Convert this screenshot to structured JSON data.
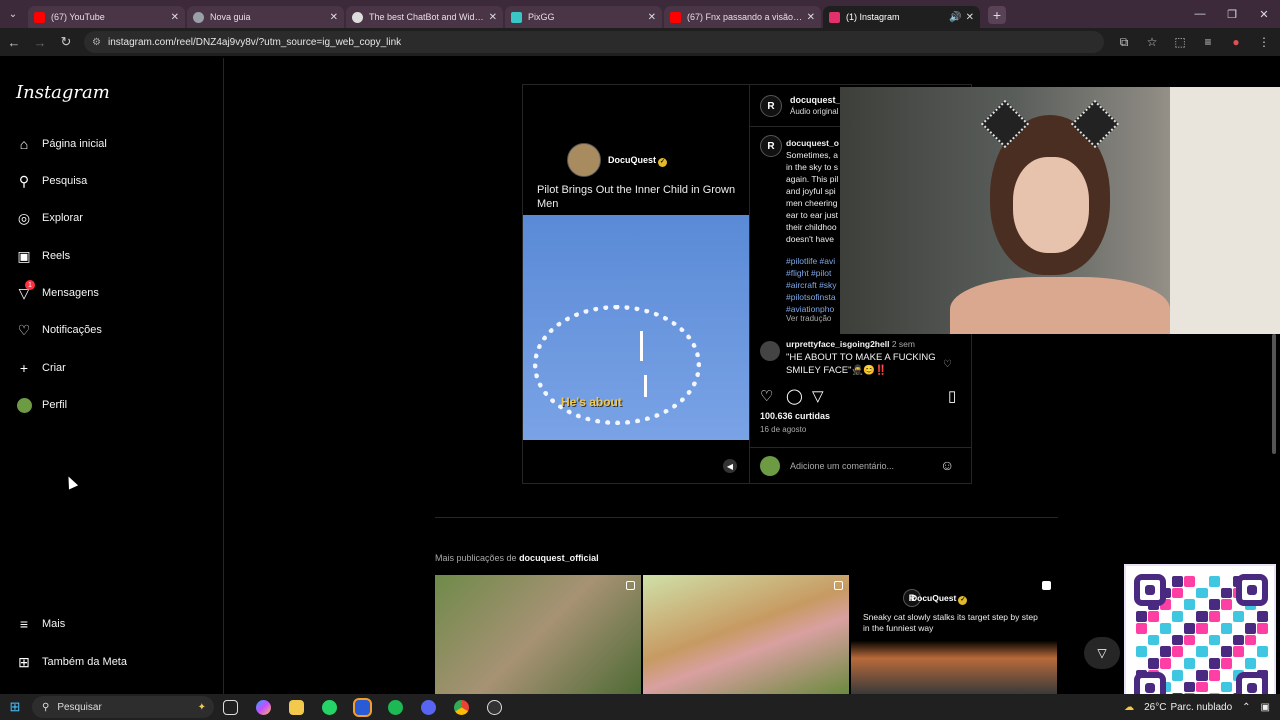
{
  "tabs": [
    {
      "title": "(67) YouTube",
      "color": "#ff0000"
    },
    {
      "title": "Nova guia",
      "color": "#9aa0a6"
    },
    {
      "title": "The best ChatBot and Widgets",
      "color": "#dddddd"
    },
    {
      "title": "PixGG",
      "color": "#38c6c6"
    },
    {
      "title": "(67) Fnx passando a visão pra",
      "color": "#ff0000"
    },
    {
      "title": "(1) Instagram",
      "color": "#e1306c",
      "active": true
    }
  ],
  "address": {
    "url": "instagram.com/reel/DNZ4aj9vy8v/?utm_source=ig_web_copy_link"
  },
  "sidebar": {
    "logo": "Instagram",
    "items": [
      {
        "label": "Página inicial",
        "icon": "home-icon"
      },
      {
        "label": "Pesquisa",
        "icon": "search-icon"
      },
      {
        "label": "Explorar",
        "icon": "compass-icon"
      },
      {
        "label": "Reels",
        "icon": "reels-icon"
      },
      {
        "label": "Mensagens",
        "icon": "messages-icon",
        "badge": "1"
      },
      {
        "label": "Notificações",
        "icon": "heart-icon"
      },
      {
        "label": "Criar",
        "icon": "plus-icon"
      },
      {
        "label": "Perfil",
        "icon": "profile-avatar"
      }
    ],
    "more": "Mais",
    "meta": "Também da Meta"
  },
  "post": {
    "media_channel": "DocuQuest",
    "media_title": "Pilot Brings Out the Inner Child in Grown Men",
    "media_caption": "He's about",
    "author": "docuquest_o",
    "audio": "Áudio original",
    "caption_user": "docuquest_o",
    "caption_lines": [
      "Sometimes, a",
      "in the sky to s",
      "again. This pil",
      "and joyful spi",
      "men cheering",
      "ear to ear just",
      "their childhoo",
      "doesn't have"
    ],
    "hashtags": [
      "#pilotlife #avi",
      "#flight #pilot",
      "#aircraft #sky",
      "#pilotsofinsta",
      "#aviationpho"
    ],
    "translate": "Ver tradução",
    "comment": {
      "user": "urprettyface_isgoing2hell",
      "time": "2 sem",
      "text": "\"HE ABOUT TO MAKE A FUCKING SMILEY FACE\"🥷😊‼️"
    },
    "likes": "100.636 curtidas",
    "date": "16 de agosto",
    "comment_placeholder": "Adicione um comentário..."
  },
  "more_posts": {
    "prefix": "Mais publicações de",
    "user": "docuquest_official",
    "third_channel": "DocuQuest",
    "third_text": "Sneaky cat slowly stalks its target step by step in the funniest way"
  },
  "taskbar": {
    "search": "Pesquisar",
    "weather": "26°C",
    "weather_desc": "Parc. nublado",
    "whatsapp_badge": "6"
  }
}
